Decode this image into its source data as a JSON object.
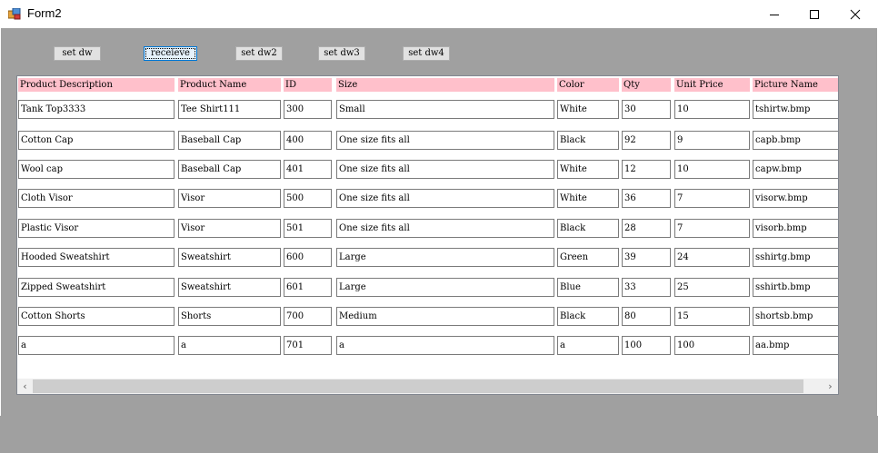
{
  "window": {
    "title": "Form2",
    "controls": {
      "minimize": "minimize-icon",
      "maximize": "maximize-icon",
      "close": "close-icon"
    }
  },
  "buttons": [
    {
      "label": "set dw"
    },
    {
      "label": "receieve"
    },
    {
      "label": "set dw2"
    },
    {
      "label": "set dw3"
    },
    {
      "label": "set dw4"
    }
  ],
  "grid": {
    "columns": [
      "Product Description",
      "Product Name",
      "ID",
      "Size",
      "Color",
      "Qty",
      "Unit Price",
      "Picture Name"
    ],
    "rows": [
      [
        "Tank Top3333",
        "Tee Shirt111",
        "300",
        "Small",
        "White",
        "30",
        "10",
        "tshirtw.bmp"
      ],
      [
        "Cotton Cap",
        "Baseball Cap",
        "400",
        "One size fits all",
        "Black",
        "92",
        "9",
        "capb.bmp"
      ],
      [
        "Wool cap",
        "Baseball Cap",
        "401",
        "One size fits all",
        "White",
        "12",
        "10",
        "capw.bmp"
      ],
      [
        "Cloth Visor",
        "Visor",
        "500",
        "One size fits all",
        "White",
        "36",
        "7",
        "visorw.bmp"
      ],
      [
        "Plastic Visor",
        "Visor",
        "501",
        "One size fits all",
        "Black",
        "28",
        "7",
        "visorb.bmp"
      ],
      [
        "Hooded Sweatshirt",
        "Sweatshirt",
        "600",
        "Large",
        "Green",
        "39",
        "24",
        "sshirtg.bmp"
      ],
      [
        "Zipped Sweatshirt",
        "Sweatshirt",
        "601",
        "Large",
        "Blue",
        "33",
        "25",
        "sshirtb.bmp"
      ],
      [
        "Cotton Shorts",
        "Shorts",
        "700",
        "Medium",
        "Black",
        "80",
        "15",
        "shortsb.bmp"
      ],
      [
        "a",
        "a",
        "701",
        "a",
        "a",
        "100",
        "100",
        "aa.bmp"
      ]
    ]
  },
  "colors": {
    "client_bg": "#a0a0a0",
    "header_bg": "#ffc0cb",
    "focus_border": "#0078d7"
  }
}
